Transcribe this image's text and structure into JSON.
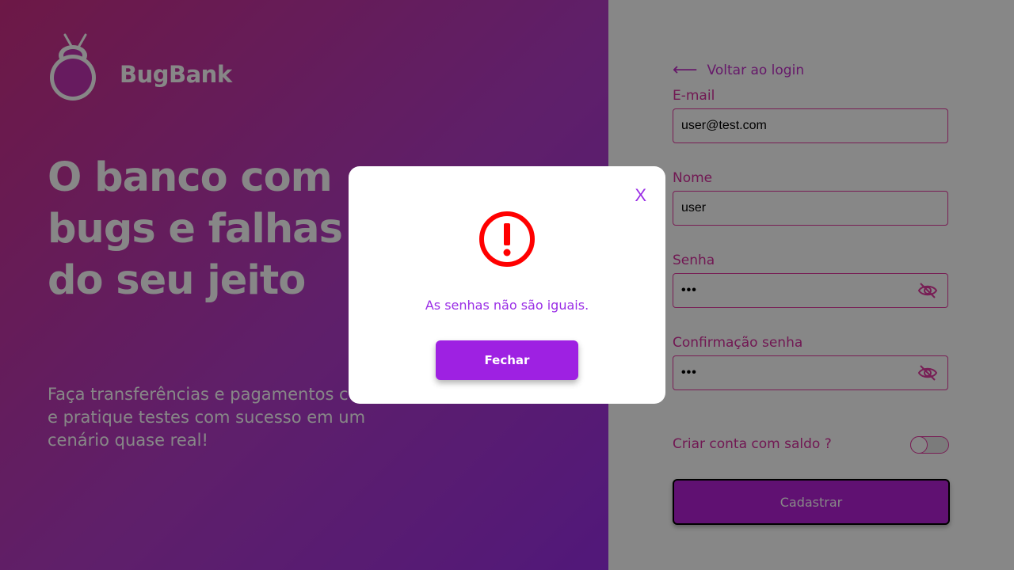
{
  "brand": {
    "name": "BugBank"
  },
  "hero": {
    "headline": "O banco com bugs e falhas do seu jeito",
    "subtext": "Faça transferências e pagamentos c bugs e pratique testes com sucesso em um cenário quase real!"
  },
  "form": {
    "back_label": "Voltar ao login",
    "email_label": "E-mail",
    "email_value": "user@test.com",
    "name_label": "Nome",
    "name_value": "user",
    "password_label": "Senha",
    "password_value": "•••",
    "confirm_label": "Confirmação senha",
    "confirm_value": "•••",
    "balance_toggle_label": "Criar conta com saldo ?",
    "submit_label": "Cadastrar"
  },
  "modal": {
    "close_label": "X",
    "message": "As senhas não são iguais.",
    "button_label": "Fechar"
  },
  "colors": {
    "gradient_start": "#ce2f85",
    "gradient_end": "#9a2ee6",
    "accent": "#9e21e2",
    "error": "#ff0000"
  }
}
